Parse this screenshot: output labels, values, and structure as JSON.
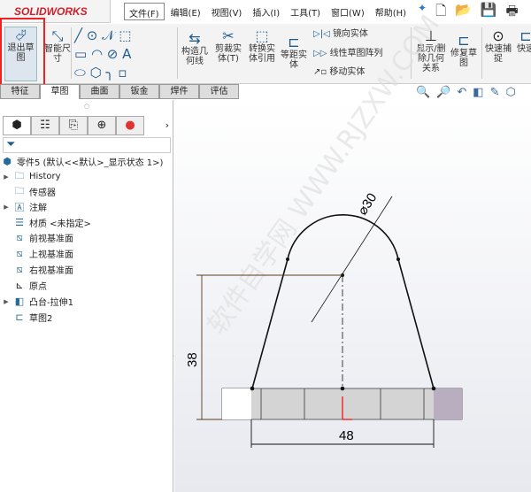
{
  "app": {
    "logo": "SOLIDWORKS"
  },
  "menu": [
    "文件(F)",
    "编辑(E)",
    "视图(V)",
    "插入(I)",
    "工具(T)",
    "窗口(W)",
    "帮助(H)"
  ],
  "quick_access": {
    "icons": [
      "pin-icon",
      "new-document-icon",
      "open-icon",
      "save-icon",
      "print-icon"
    ],
    "pin": "✦",
    "new": "🗋",
    "open": "📂",
    "save": "💾",
    "print": "🖶"
  },
  "ribbon": {
    "exit_sketch": "退出草图",
    "smart_dimension": "智能尺寸",
    "construction": "构造几何线",
    "trim": "剪裁实体(T)",
    "convert": "转换实体引用",
    "offset": "等距实体",
    "mirror": "镜向实体",
    "linear_pattern": "线性草图阵列",
    "move": "移动实体",
    "relations": "显示/删除几何关系",
    "repair": "修复草图",
    "quick_snap": "快速捕捉",
    "quick_view": "快速"
  },
  "tabs": [
    "特征",
    "草图",
    "曲面",
    "钣金",
    "焊件",
    "评估"
  ],
  "active_tab": "草图",
  "tree": {
    "root": "零件5 (默认<<默认>_显示状态 1>)",
    "items": [
      "History",
      "传感器",
      "注解",
      "材质 <未指定>",
      "前视基准面",
      "上视基准面",
      "右视基准面",
      "原点",
      "凸台-拉伸1",
      "草图2"
    ]
  },
  "dimensions": {
    "diameter": "⌀30",
    "height": "38",
    "width": "48"
  },
  "watermark": "软件自学网 WWW.RJZXW.COM",
  "colors": {
    "highlight": "#e22222",
    "sketch_line": "#111111",
    "dimension_line": "#5a3a1a"
  }
}
